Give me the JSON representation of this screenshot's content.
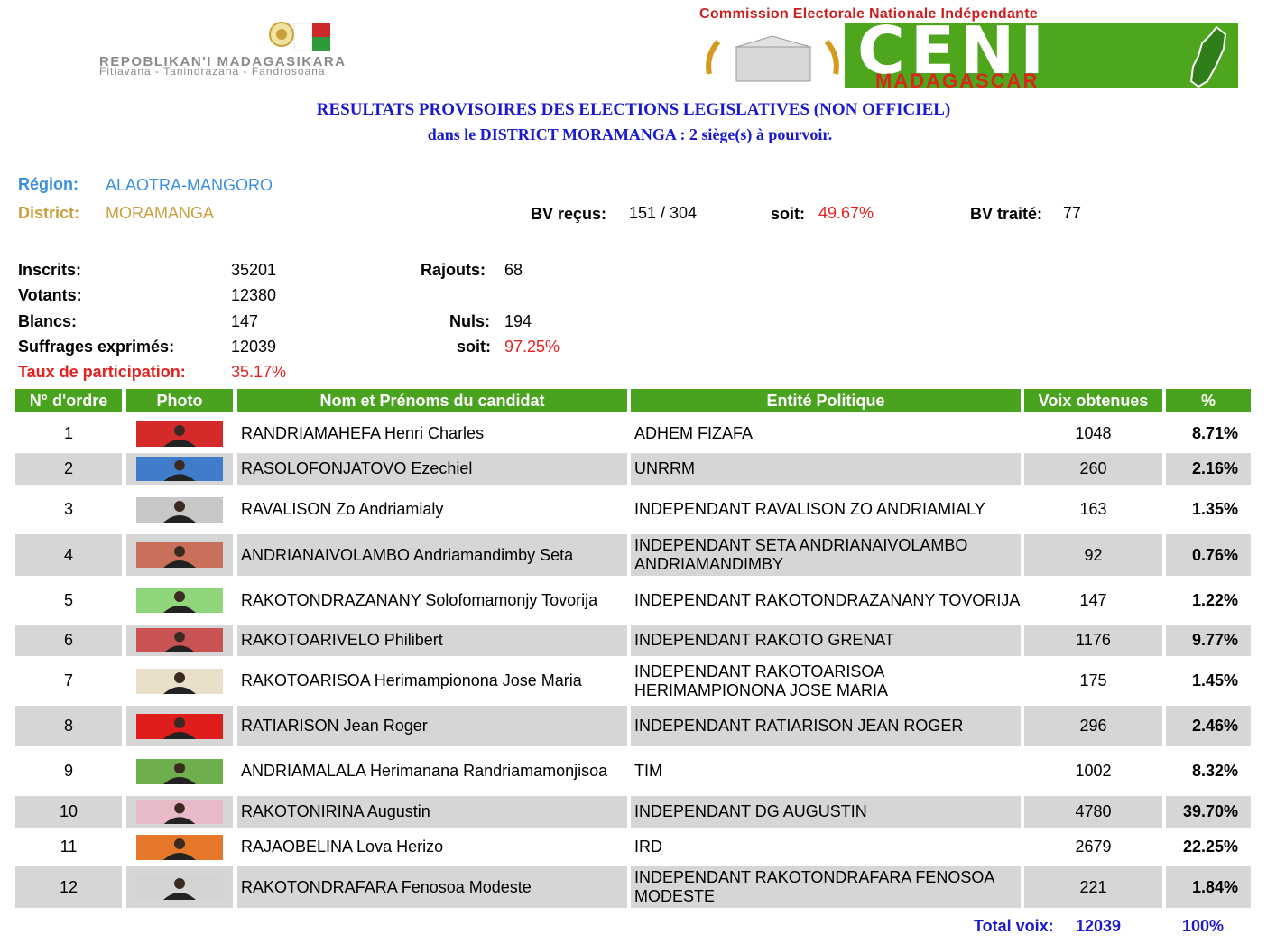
{
  "header": {
    "republic_name": "REPOBLIKAN'I MADAGASIKARA",
    "republic_motto": "Fitiavana - Tanindrazana - Fandrosoana",
    "ceni_full": "Commission Electorale Nationale Indépendante",
    "ceni_acronym": "CENI",
    "ceni_country": "MADAGASCAR"
  },
  "title": {
    "line1": "RESULTATS PROVISOIRES DES ELECTIONS LEGISLATIVES (NON OFFICIEL)",
    "line2": "dans le DISTRICT  MORAMANGA : 2 siège(s) à pourvoir."
  },
  "info": {
    "region_label": "Région:",
    "region_value": "ALAOTRA-MANGORO",
    "district_label": "District:",
    "district_value": "MORAMANGA",
    "bv_recus_label": "BV reçus:",
    "bv_recus_value": "151 / 304",
    "soit1_label": "soit:",
    "soit1_value": "49.67%",
    "bv_traite_label": "BV traité:",
    "bv_traite_value": "77"
  },
  "stats": {
    "inscrits_label": "Inscrits:",
    "inscrits_value": "35201",
    "rajouts_label": "Rajouts:",
    "rajouts_value": "68",
    "votants_label": "Votants:",
    "votants_value": "12380",
    "blancs_label": "Blancs:",
    "blancs_value": "147",
    "nuls_label": "Nuls:",
    "nuls_value": "194",
    "suffrages_label": "Suffrages exprimés:",
    "suffrages_value": "12039",
    "soit2_label": "soit:",
    "soit2_value": "97.25%",
    "taux_label": "Taux de participation:",
    "taux_value": "35.17%"
  },
  "table": {
    "headers": [
      "N° d'ordre",
      "Photo",
      "Nom et Prénoms du candidat",
      "Entité Politique",
      "Voix obtenues",
      "%"
    ],
    "rows": [
      {
        "num": "1",
        "name": "RANDRIAMAHEFA Henri Charles",
        "party": "ADHEM FIZAFA",
        "votes": "1048",
        "pct": "8.71%",
        "photo_bg": "#d42a2a"
      },
      {
        "num": "2",
        "name": "RASOLOFONJATOVO Ezechiel",
        "party": "UNRRM",
        "votes": "260",
        "pct": "2.16%",
        "photo_bg": "#3f7cc9"
      },
      {
        "num": "3",
        "name": "RAVALISON Zo Andriamialy",
        "party": "INDEPENDANT RAVALISON ZO ANDRIAMIALY",
        "votes": "163",
        "pct": "1.35%",
        "photo_bg": "#c8c8c8"
      },
      {
        "num": "4",
        "name": "ANDRIANAIVOLAMBO Andriamandimby Seta",
        "party": "INDEPENDANT SETA ANDRIANAIVOLAMBO ANDRIAMANDIMBY",
        "votes": "92",
        "pct": "0.76%",
        "photo_bg": "#c9705a"
      },
      {
        "num": "5",
        "name": "RAKOTONDRAZANANY Solofomamonjy Tovorija",
        "party": "INDEPENDANT RAKOTONDRAZANANY TOVORIJA",
        "votes": "147",
        "pct": "1.22%",
        "photo_bg": "#8fd67a"
      },
      {
        "num": "6",
        "name": "RAKOTOARIVELO Philibert",
        "party": "INDEPENDANT RAKOTO GRENAT",
        "votes": "1176",
        "pct": "9.77%",
        "photo_bg": "#c95252"
      },
      {
        "num": "7",
        "name": "RAKOTOARISOA Herimampionona Jose Maria",
        "party": "INDEPENDANT RAKOTOARISOA HERIMAMPIONONA JOSE MARIA",
        "votes": "175",
        "pct": "1.45%",
        "photo_bg": "#eadfc9"
      },
      {
        "num": "8",
        "name": "RATIARISON Jean Roger",
        "party": "INDEPENDANT RATIARISON JEAN ROGER",
        "votes": "296",
        "pct": "2.46%",
        "photo_bg": "#e01d1d"
      },
      {
        "num": "9",
        "name": "ANDRIAMALALA Herimanana Randriamamonjisoa",
        "party": "TIM",
        "votes": "1002",
        "pct": "8.32%",
        "photo_bg": "#6fae4d"
      },
      {
        "num": "10",
        "name": "RAKOTONIRINA Augustin",
        "party": "INDEPENDANT DG AUGUSTIN",
        "votes": "4780",
        "pct": "39.70%",
        "photo_bg": "#e8b9c6"
      },
      {
        "num": "11",
        "name": "RAJAOBELINA Lova Herizo",
        "party": "IRD",
        "votes": "2679",
        "pct": "22.25%",
        "photo_bg": "#e4772a"
      },
      {
        "num": "12",
        "name": "RAKOTONDRAFARA Fenosoa Modeste",
        "party": "INDEPENDANT RAKOTONDRAFARA FENOSOA MODESTE",
        "votes": "221",
        "pct": "1.84%",
        "photo_bg": "#d4d4d4"
      }
    ],
    "total_label": "Total voix:",
    "total_value": "12039",
    "total_pct": "100%"
  }
}
